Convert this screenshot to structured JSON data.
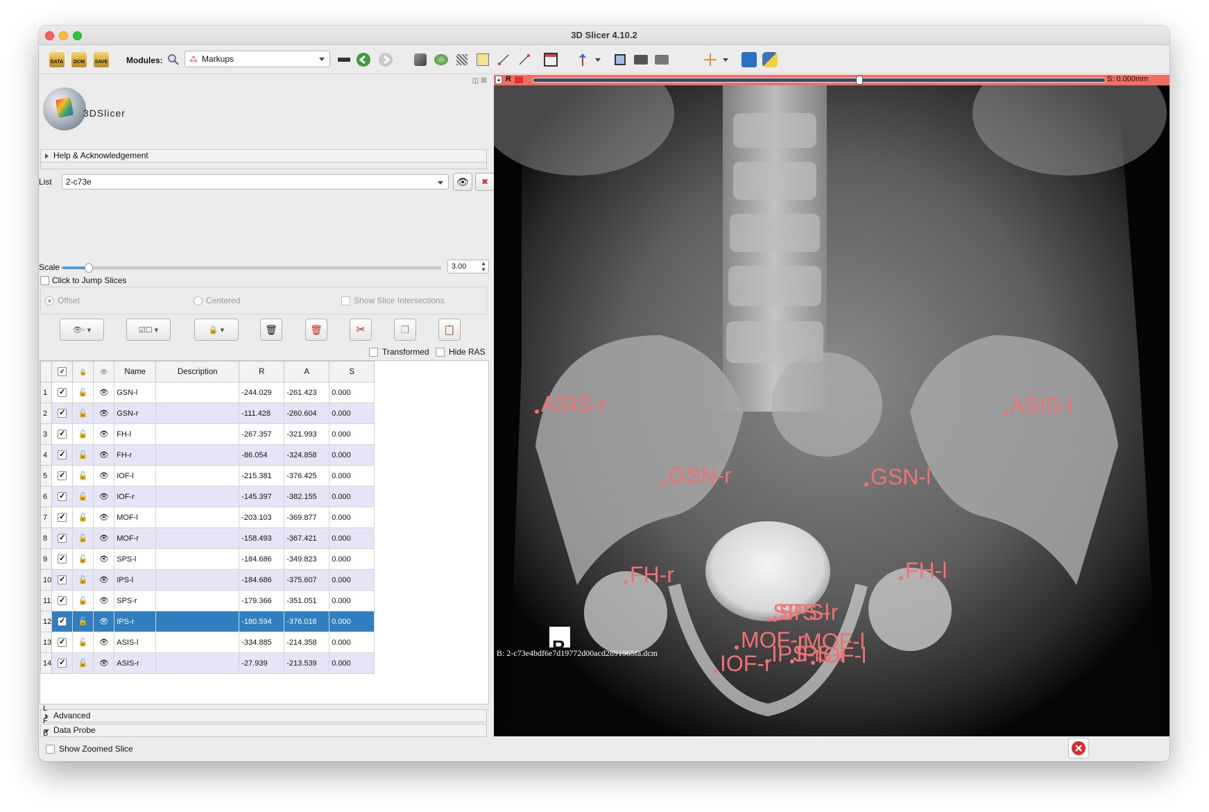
{
  "window": {
    "title": "3D Slicer 4.10.2"
  },
  "toolbar": {
    "modules_label": "Modules:",
    "module_selected": "Markups",
    "icons": [
      "data-icon",
      "dcm-icon",
      "save-icon",
      "search-icon",
      "layout-icon",
      "back-icon",
      "forward-icon",
      "volume-icon",
      "models-icon",
      "transforms-icon",
      "editor-icon",
      "markups-icon",
      "ruler-icon",
      "layout-grid-icon",
      "crosshair-arrow-icon",
      "screenshot-icon",
      "camera-icon",
      "scene-icon",
      "crosshair-icon",
      "extension-icon",
      "python-icon"
    ]
  },
  "module_panel": {
    "logo_text": "3DSlicer",
    "help_section": "Help & Acknowledgement",
    "list_label": "List",
    "list_value": "2-c73e",
    "scale_label": "Scale",
    "scale_value": 3.0,
    "scale_display": "3.00",
    "click_to_jump": "Click to Jump Slices",
    "offset_label": "Offset",
    "centered_label": "Centered",
    "show_slice_intersections": "Show Slice Intersections",
    "transformed_label": "Transformed",
    "hide_ras_label": "Hide RAS",
    "table": {
      "columns": [
        "Name",
        "Description",
        "R",
        "A",
        "S"
      ],
      "rows": [
        {
          "num": "1",
          "name": "GSN-l",
          "desc": "",
          "r": "-244.029",
          "a": "-261.423",
          "s": "0.000"
        },
        {
          "num": "2",
          "name": "GSN-r",
          "desc": "",
          "r": "-111.428",
          "a": "-260.604",
          "s": "0.000"
        },
        {
          "num": "3",
          "name": "FH-l",
          "desc": "",
          "r": "-267.357",
          "a": "-321.993",
          "s": "0.000"
        },
        {
          "num": "4",
          "name": "FH-r",
          "desc": "",
          "r": "-86.054",
          "a": "-324.858",
          "s": "0.000"
        },
        {
          "num": "5",
          "name": "IOF-l",
          "desc": "",
          "r": "-215.381",
          "a": "-376.425",
          "s": "0.000"
        },
        {
          "num": "6",
          "name": "IOF-r",
          "desc": "",
          "r": "-145.397",
          "a": "-382.155",
          "s": "0.000"
        },
        {
          "num": "7",
          "name": "MOF-l",
          "desc": "",
          "r": "-203.103",
          "a": "-369.877",
          "s": "0.000"
        },
        {
          "num": "8",
          "name": "MOF-r",
          "desc": "",
          "r": "-158.493",
          "a": "-367.421",
          "s": "0.000"
        },
        {
          "num": "9",
          "name": "SPS-l",
          "desc": "",
          "r": "-184.686",
          "a": "-349.823",
          "s": "0.000"
        },
        {
          "num": "10",
          "name": "IPS-l",
          "desc": "",
          "r": "-184.686",
          "a": "-375.607",
          "s": "0.000"
        },
        {
          "num": "11",
          "name": "SPS-r",
          "desc": "",
          "r": "-179.366",
          "a": "-351.051",
          "s": "0.000"
        },
        {
          "num": "12",
          "name": "IPS-r",
          "desc": "",
          "r": "-180.594",
          "a": "-376.016",
          "s": "0.000"
        },
        {
          "num": "13",
          "name": "ASIS-l",
          "desc": "",
          "r": "-334.885",
          "a": "-214.358",
          "s": "0.000"
        },
        {
          "num": "14",
          "name": "ASIS-r",
          "desc": "",
          "r": "-27.939",
          "a": "-213.539",
          "s": "0.000"
        }
      ],
      "selected_row": 12
    },
    "advanced_section": "Advanced",
    "data_probe_section": "Data Probe",
    "show_zoomed_slice": "Show Zoomed Slice",
    "probe_labels": [
      "L",
      "F",
      "B"
    ]
  },
  "viewer": {
    "slice_letter": "R",
    "slice_offset": "S: 0.000mm",
    "background_label": "B: 2-c73e4bdf6e7d19772d00acd2891965fa.dcm",
    "orientation_marker": "R",
    "fiducial_color": "#f07272",
    "fiducials": [
      {
        "label": "ASIS-r"
      },
      {
        "label": "ASIS-l"
      },
      {
        "label": "GSN-r"
      },
      {
        "label": "GSN-l"
      },
      {
        "label": "FH-r"
      },
      {
        "label": "FH-l"
      },
      {
        "label": "SPS-l"
      },
      {
        "label": "SPS-r"
      },
      {
        "label": "MOF-r"
      },
      {
        "label": "MOF-l"
      },
      {
        "label": "IPS-r"
      },
      {
        "label": "IPS-l"
      },
      {
        "label": "IOF-r"
      },
      {
        "label": "IOF-l"
      }
    ]
  },
  "colors": {
    "selection": "#2f7fc1",
    "alt_row": "#e5e5f7",
    "slice_bar": "#f26e61"
  }
}
